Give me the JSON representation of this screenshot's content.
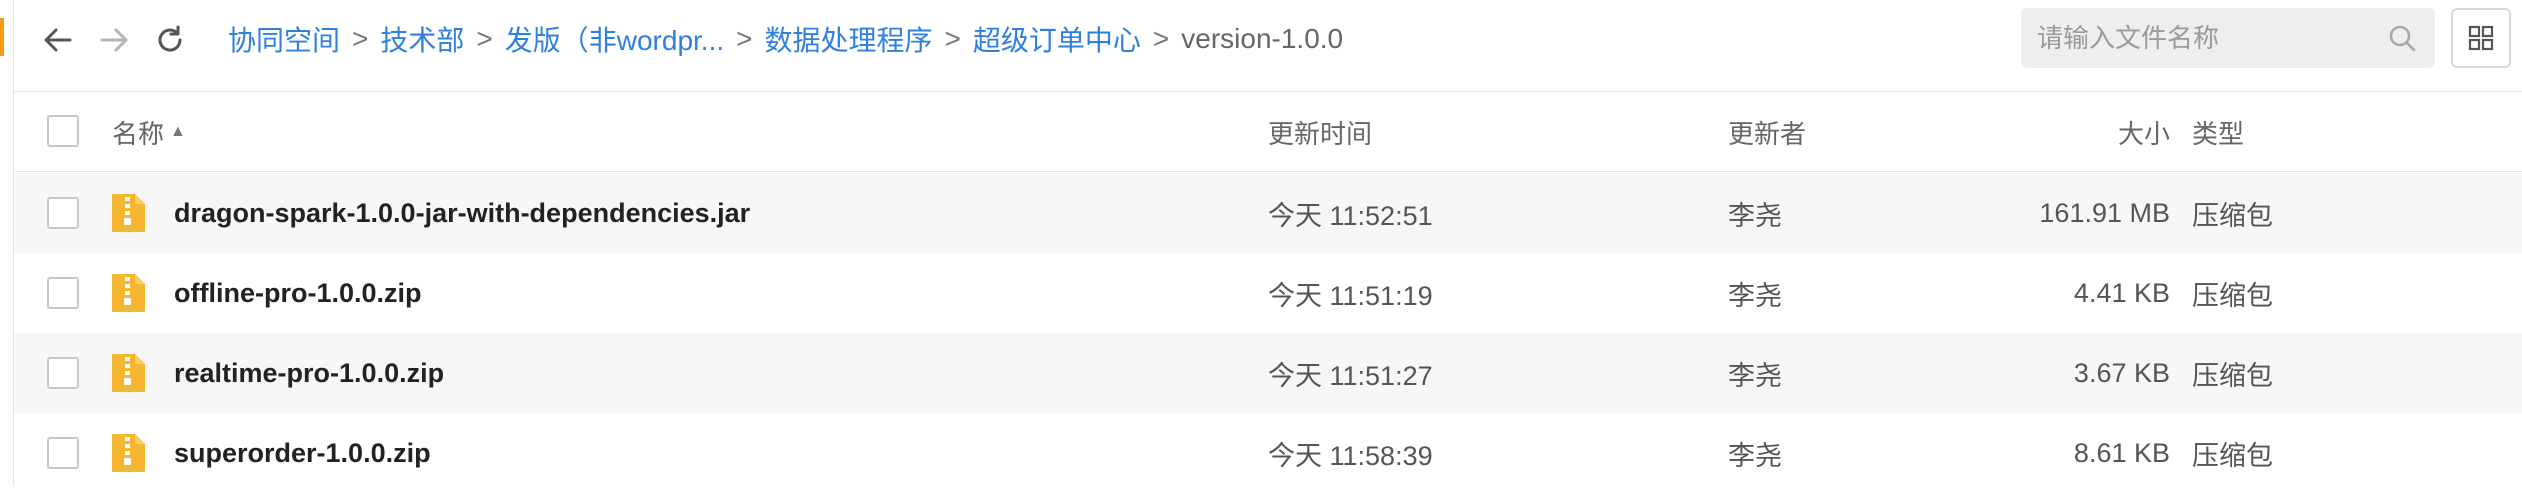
{
  "breadcrumbs": {
    "items": [
      "协同空间",
      "技术部",
      "发版（非wordpr...",
      "数据处理程序",
      "超级订单中心"
    ],
    "separator": ">",
    "current": "version-1.0.0"
  },
  "search": {
    "placeholder": "请输入文件名称",
    "value": ""
  },
  "table": {
    "headers": {
      "name": "名称",
      "updated_time": "更新时间",
      "updater": "更新者",
      "size": "大小",
      "type": "类型"
    },
    "sort_indicator": "▲",
    "rows": [
      {
        "name": "dragon-spark-1.0.0-jar-with-dependencies.jar",
        "updated_time": "今天 11:52:51",
        "updater": "李尧",
        "size": "161.91 MB",
        "type": "压缩包"
      },
      {
        "name": "offline-pro-1.0.0.zip",
        "updated_time": "今天 11:51:19",
        "updater": "李尧",
        "size": "4.41 KB",
        "type": "压缩包"
      },
      {
        "name": "realtime-pro-1.0.0.zip",
        "updated_time": "今天 11:51:27",
        "updater": "李尧",
        "size": "3.67 KB",
        "type": "压缩包"
      },
      {
        "name": "superorder-1.0.0.zip",
        "updated_time": "今天 11:58:39",
        "updater": "李尧",
        "size": "8.61 KB",
        "type": "压缩包"
      }
    ]
  },
  "icons": {
    "back": "arrow-left-icon",
    "forward": "arrow-right-icon",
    "refresh": "refresh-icon",
    "search": "search-icon",
    "view_toggle": "grid-view-icon",
    "file": "zip-file-icon"
  },
  "colors": {
    "link": "#2f7fe0",
    "file_icon": "#f5b731",
    "accent": "#f39c12"
  }
}
